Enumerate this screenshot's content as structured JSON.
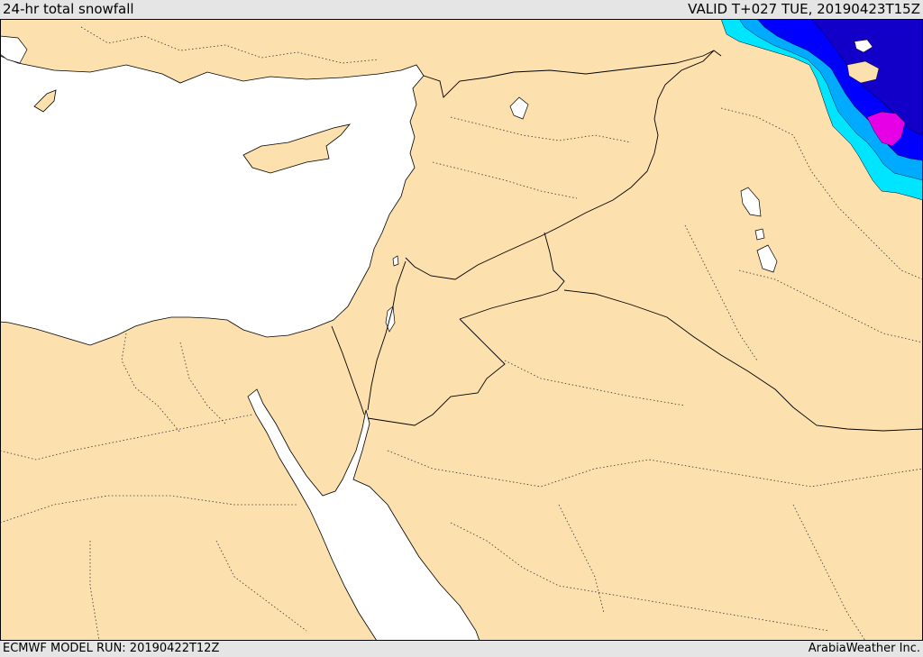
{
  "header": {
    "title": "24-hr total snowfall",
    "valid": "VALID T+027 TUE, 20190423T15Z"
  },
  "footer": {
    "model_run": "ECMWF MODEL RUN: 20190422T12Z",
    "credit": "ArabiaWeather Inc."
  },
  "map": {
    "colors": {
      "land": "#fce0ad",
      "water": "#ffffff",
      "border": "#000000",
      "snow_light": "#00e5ff",
      "snow_mid": "#00aaff",
      "snow_heavy": "#0000ff",
      "snow_deep": "#1200c8",
      "snow_max": "#e600e6"
    }
  }
}
